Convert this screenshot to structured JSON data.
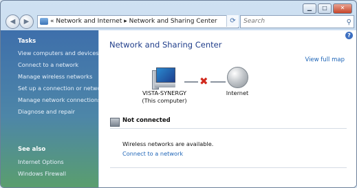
{
  "window": {
    "minimize": "▁",
    "maximize": "□",
    "close": "✕"
  },
  "nav": {
    "back": "◀",
    "forward": "▶",
    "breadcrumb": [
      "Network and Internet",
      "Network and Sharing Center"
    ],
    "search_placeholder": "Search"
  },
  "sidebar": {
    "tasks_heading": "Tasks",
    "tasks": [
      "View computers and devices",
      "Connect to a network",
      "Manage wireless networks",
      "Set up a connection or network",
      "Manage network connections",
      "Diagnose and repair"
    ],
    "see_also_heading": "See also",
    "see_also": [
      "Internet Options",
      "Windows Firewall"
    ]
  },
  "main": {
    "title": "Network and Sharing Center",
    "view_full_map": "View full map",
    "computer_name": "VISTA-SYNERGY",
    "computer_sub": "(This computer)",
    "internet_label": "Internet",
    "status": "Not connected",
    "wireless_message": "Wireless networks are available.",
    "connect_link": "Connect to a network"
  }
}
